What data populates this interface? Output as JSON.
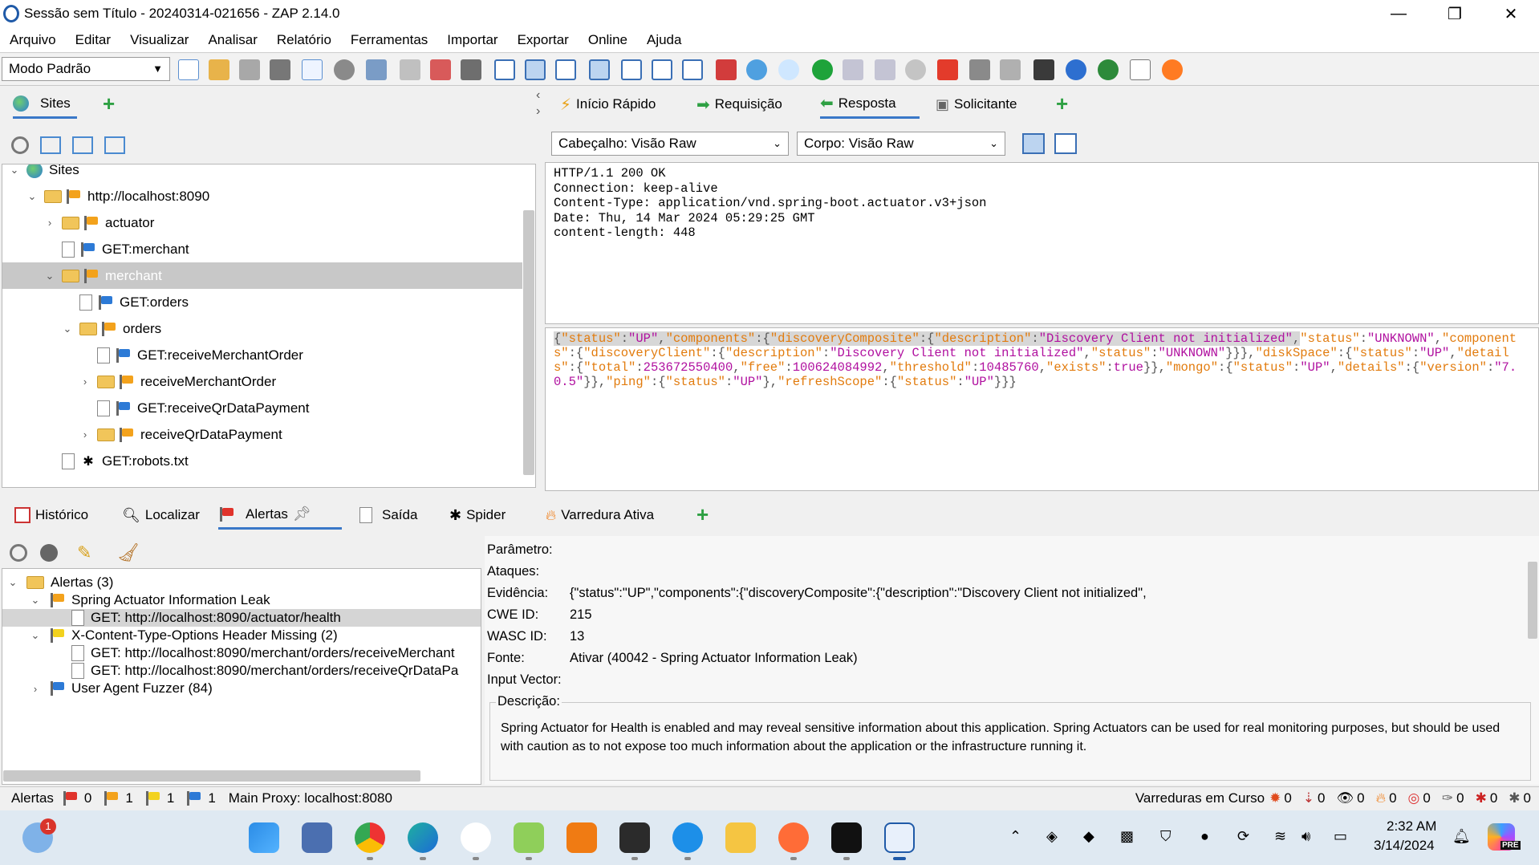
{
  "window": {
    "title": "Sessão sem Título - 20240314-021656 - ZAP 2.14.0",
    "minimize": "—",
    "maximize": "❐",
    "close": "✕"
  },
  "menu": [
    "Arquivo",
    "Editar",
    "Visualizar",
    "Analisar",
    "Relatório",
    "Ferramentas",
    "Importar",
    "Exportar",
    "Online",
    "Ajuda"
  ],
  "toolbar": {
    "mode": "Modo Padrão"
  },
  "sites_panel": {
    "tab": "Sites",
    "tree": [
      {
        "label": "Sites",
        "depth": 0,
        "chev": "⌄",
        "icon": "globe"
      },
      {
        "label": "http://localhost:8090",
        "depth": 1,
        "chev": "⌄",
        "icon": "folder-flag"
      },
      {
        "label": "actuator",
        "depth": 2,
        "chev": "›",
        "icon": "folder-flag"
      },
      {
        "label": "GET:merchant",
        "depth": 2,
        "chev": "",
        "icon": "page-flag"
      },
      {
        "label": "merchant",
        "depth": 2,
        "chev": "⌄",
        "icon": "folder-flag"
      },
      {
        "label": "GET:orders",
        "depth": 3,
        "chev": "",
        "icon": "page-flag"
      },
      {
        "label": "orders",
        "depth": 3,
        "chev": "⌄",
        "icon": "folder-flag"
      },
      {
        "label": "GET:receiveMerchantOrder",
        "depth": 4,
        "chev": "",
        "icon": "page-flag"
      },
      {
        "label": "receiveMerchantOrder",
        "depth": 4,
        "chev": "›",
        "icon": "folder-flag"
      },
      {
        "label": "GET:receiveQrDataPayment",
        "depth": 4,
        "chev": "",
        "icon": "page-flag"
      },
      {
        "label": "receiveQrDataPayment",
        "depth": 4,
        "chev": "›",
        "icon": "folder-flag"
      },
      {
        "label": "GET:robots.txt",
        "depth": 2,
        "chev": "",
        "icon": "page-spider"
      }
    ]
  },
  "right_tabs": [
    "Início Rápido",
    "Requisição",
    "Resposta",
    "Solicitante"
  ],
  "header_view": "Cabeçalho: Visão Raw",
  "body_view": "Corpo: Visão Raw",
  "response_header": "HTTP/1.1 200 OK\nConnection: keep-alive\nContent-Type: application/vnd.spring-boot.actuator.v3+json\nDate: Thu, 14 Mar 2024 05:29:25 GMT\ncontent-length: 448",
  "bottom_tabs": [
    "Histórico",
    "Localizar",
    "Alertas",
    "Saída",
    "Spider",
    "Varredura Ativa"
  ],
  "alerts_tree": [
    {
      "label": "Alertas (3)",
      "depth": 0,
      "chev": "⌄",
      "icon": "folder"
    },
    {
      "label": "Spring Actuator Information Leak",
      "depth": 1,
      "chev": "⌄",
      "icon": "orange"
    },
    {
      "label": "GET: http://localhost:8090/actuator/health",
      "depth": 2,
      "chev": "",
      "icon": "page"
    },
    {
      "label": "X-Content-Type-Options Header Missing (2)",
      "depth": 1,
      "chev": "⌄",
      "icon": "yellow"
    },
    {
      "label": "GET: http://localhost:8090/merchant/orders/receiveMerchant",
      "depth": 2,
      "chev": "",
      "icon": "page"
    },
    {
      "label": "GET: http://localhost:8090/merchant/orders/receiveQrDataPa",
      "depth": 2,
      "chev": "",
      "icon": "page"
    },
    {
      "label": "User Agent Fuzzer (84)",
      "depth": 1,
      "chev": "›",
      "icon": "blue"
    }
  ],
  "alert_detail": {
    "param_label": "Parâmetro:",
    "attack_label": "Ataques:",
    "evidence_label": "Evidência:",
    "evidence": "{\"status\":\"UP\",\"components\":{\"discoveryComposite\":{\"description\":\"Discovery Client not initialized\",",
    "cwe_label": "CWE ID:",
    "cwe": "215",
    "wasc_label": "WASC ID:",
    "wasc": "13",
    "source_label": "Fonte:",
    "source": "Ativar (40042 - Spring Actuator Information Leak)",
    "vector_label": "Input Vector:",
    "desc_label": "Descrição:",
    "description": "Spring Actuator for Health is enabled and may reveal sensitive information about this application. Spring Actuators can be used for real monitoring purposes, but should be used with caution as to not expose too much information about the application or the infrastructure running it."
  },
  "statusbar": {
    "alerts_label": "Alertas",
    "red": "0",
    "orange": "1",
    "yellow": "1",
    "blue": "1",
    "proxy": "Main Proxy: localhost:8080",
    "scans_label": "Varreduras em Curso",
    "counts": [
      "0",
      "0",
      "0",
      "0",
      "0",
      "0",
      "0",
      "0"
    ]
  },
  "taskbar": {
    "time": "2:32 AM",
    "date": "3/14/2024",
    "badge": "1",
    "pre": "PRE"
  }
}
